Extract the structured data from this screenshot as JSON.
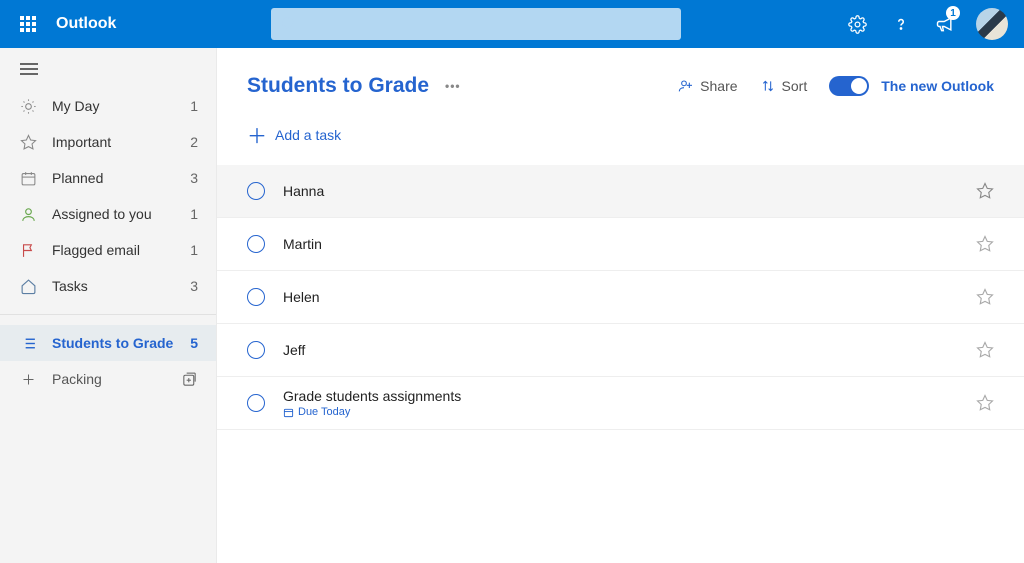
{
  "header": {
    "brand": "Outlook",
    "search_placeholder": "",
    "notification_count": "1"
  },
  "sidebar": {
    "items": [
      {
        "icon": "sun",
        "label": "My Day",
        "count": "1"
      },
      {
        "icon": "star",
        "label": "Important",
        "count": "2"
      },
      {
        "icon": "calendar",
        "label": "Planned",
        "count": "3"
      },
      {
        "icon": "person",
        "label": "Assigned to you",
        "count": "1"
      },
      {
        "icon": "flag",
        "label": "Flagged email",
        "count": "1"
      },
      {
        "icon": "home",
        "label": "Tasks",
        "count": "3"
      }
    ],
    "custom_lists": [
      {
        "icon": "list",
        "label": "Students to Grade",
        "count": "5",
        "active": true
      },
      {
        "icon": "plus",
        "label": "Packing",
        "trailing": "new-group"
      }
    ]
  },
  "main": {
    "title": "Students to Grade",
    "actions": {
      "share": "Share",
      "sort": "Sort",
      "toggle_label": "The new Outlook"
    },
    "add_task_placeholder": "Add a task",
    "tasks": [
      {
        "title": "Hanna",
        "meta": ""
      },
      {
        "title": "Martin",
        "meta": ""
      },
      {
        "title": "Helen",
        "meta": ""
      },
      {
        "title": "Jeff",
        "meta": ""
      },
      {
        "title": "Grade students assignments",
        "meta": "Due Today"
      }
    ]
  }
}
